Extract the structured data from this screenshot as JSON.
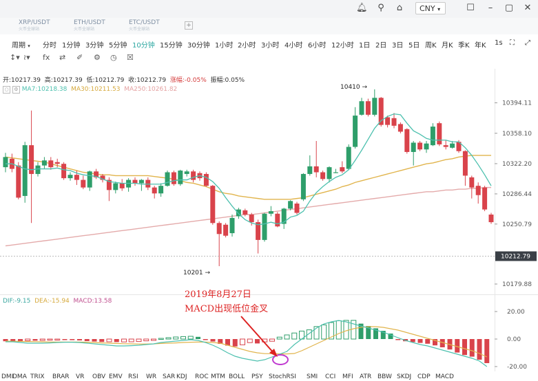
{
  "topbar": {
    "icons": [
      "bell-icon",
      "search-icon",
      "shirt-icon",
      "calendar-icon",
      "minimize-icon",
      "maximize-icon",
      "close-icon"
    ],
    "currency": "CNY"
  },
  "tabs": [
    {
      "label": "XRP/USDT",
      "sub": "火币全球站"
    },
    {
      "label": "ETH/USDT",
      "sub": "火币全球站"
    },
    {
      "label": "ETC/USDT",
      "sub": "火币全球站"
    }
  ],
  "periods": [
    "周期",
    "分时",
    "1分钟",
    "3分钟",
    "5分钟",
    "10分钟",
    "15分钟",
    "30分钟",
    "1小时",
    "2小时",
    "3小时",
    "4小时",
    "6小时",
    "12小时",
    "1日",
    "2日",
    "3日",
    "5日",
    "周K",
    "月K",
    "季K",
    "年K",
    "1s"
  ],
  "active_period": "10分钟",
  "ohlc": {
    "open": "开:10217.39",
    "high": "高:10217.39",
    "low": "低:10212.79",
    "close": "收:10212.79",
    "change": "涨幅:-0.05%",
    "amplitude": "振幅:0.05%"
  },
  "ma": {
    "ma7": "MA7:10218.38",
    "ma30": "MA30:10211.53",
    "ma250": "MA250:10261.82"
  },
  "macd_legend": {
    "dif": "DIF:-9.15",
    "dea": "DEA:-15.94",
    "macd": "MACD:13.58"
  },
  "annotation": {
    "line1": "2019年8月27日",
    "line2": "MACD出现低位金叉"
  },
  "price_markers": {
    "high": "10410",
    "low": "10201",
    "current": "10212.79"
  },
  "indicators": [
    "DMI",
    "DMA",
    "TRIX",
    "BRAR",
    "VR",
    "OBV",
    "EMV",
    "RSI",
    "WR",
    "SAR",
    "KDJ",
    "ROC",
    "MTM",
    "BOLL",
    "PSY",
    "StochRSI",
    "SMI",
    "CCI",
    "MFI",
    "ATR",
    "BBW",
    "SKDJ",
    "CDP",
    "MACD"
  ],
  "colors": {
    "up": "#2e9e6a",
    "down": "#d9434b",
    "ma7": "#4cc0ae",
    "ma30": "#e1b44c",
    "ma250": "#e4aaaa",
    "active": "#2aa6a0"
  },
  "chart_data": [
    {
      "type": "candlestick",
      "y_axis_ticks": [
        10394.11,
        10358.1,
        10322.2,
        10286.44,
        10250.79,
        10179.88
      ],
      "ylim": [
        10170,
        10420
      ],
      "high_marker": 10410,
      "low_marker": 10201,
      "last_price": 10212.79,
      "candles": [
        [
          10318,
          10330,
          10312,
          10335
        ],
        [
          10328,
          10316,
          10312,
          10334
        ],
        [
          10320,
          10282,
          10280,
          10324
        ],
        [
          10284,
          10344,
          10276,
          10348
        ],
        [
          10344,
          10310,
          10252,
          10385
        ],
        [
          10310,
          10320,
          10307,
          10324
        ],
        [
          10320,
          10326,
          10316,
          10330
        ],
        [
          10326,
          10318,
          10315,
          10330
        ],
        [
          10324,
          10322,
          10318,
          10328
        ],
        [
          10322,
          10305,
          10303,
          10324
        ],
        [
          10305,
          10309,
          10302,
          10312
        ],
        [
          10309,
          10303,
          10297,
          10314
        ],
        [
          10303,
          10294,
          10292,
          10308
        ],
        [
          10294,
          10313,
          10290,
          10314
        ],
        [
          10313,
          10306,
          10304,
          10316
        ],
        [
          10308,
          10303,
          10300,
          10310
        ],
        [
          10303,
          10291,
          10278,
          10306
        ],
        [
          10291,
          10299,
          10287,
          10301
        ],
        [
          10299,
          10293,
          10290,
          10304
        ],
        [
          10294,
          10303,
          10289,
          10305
        ],
        [
          10303,
          10299,
          10296,
          10306
        ],
        [
          10299,
          10303,
          10290,
          10304
        ],
        [
          10303,
          10294,
          10291,
          10306
        ],
        [
          10294,
          10287,
          10281,
          10296
        ],
        [
          10287,
          10296,
          10283,
          10299
        ],
        [
          10296,
          10312,
          10295,
          10314
        ],
        [
          10312,
          10298,
          10296,
          10314
        ],
        [
          10298,
          10314,
          10296,
          10315
        ],
        [
          10310,
          10313,
          10307,
          10315
        ],
        [
          10313,
          10303,
          10300,
          10315
        ],
        [
          10311,
          10305,
          10302,
          10313
        ],
        [
          10310,
          10296,
          10295,
          10312
        ],
        [
          10296,
          10252,
          10250,
          10297
        ],
        [
          10252,
          10239,
          10201,
          10254
        ],
        [
          10250,
          10237,
          10235,
          10252
        ],
        [
          10240,
          10258,
          10236,
          10262
        ],
        [
          10260,
          10268,
          10257,
          10270
        ],
        [
          10267,
          10262,
          10260,
          10269
        ],
        [
          10262,
          10253,
          10249,
          10264
        ],
        [
          10253,
          10232,
          10216,
          10256
        ],
        [
          10232,
          10263,
          10230,
          10264
        ],
        [
          10263,
          10266,
          10260,
          10272
        ],
        [
          10263,
          10248,
          10247,
          10265
        ],
        [
          10251,
          10269,
          10245,
          10270
        ],
        [
          10269,
          10278,
          10267,
          10279
        ],
        [
          10275,
          10264,
          10262,
          10277
        ],
        [
          10280,
          10310,
          10278,
          10311
        ],
        [
          10310,
          10319,
          10308,
          10332
        ],
        [
          10319,
          10312,
          10306,
          10349
        ],
        [
          10312,
          10304,
          10302,
          10314
        ],
        [
          10304,
          10318,
          10300,
          10319
        ],
        [
          10312,
          10312,
          10311,
          10316
        ],
        [
          10318,
          10313,
          10311,
          10325
        ],
        [
          10316,
          10342,
          10315,
          10345
        ],
        [
          10342,
          10379,
          10340,
          10389
        ],
        [
          10380,
          10396,
          10379,
          10400
        ],
        [
          10396,
          10380,
          10378,
          10399
        ],
        [
          10380,
          10400,
          10378,
          10410
        ],
        [
          10400,
          10368,
          10366,
          10401
        ],
        [
          10377,
          10368,
          10365,
          10379
        ],
        [
          10376,
          10367,
          10364,
          10382
        ],
        [
          10369,
          10360,
          10358,
          10371
        ],
        [
          10363,
          10336,
          10334,
          10364
        ],
        [
          10336,
          10347,
          10320,
          10349
        ],
        [
          10347,
          10339,
          10337,
          10349
        ],
        [
          10339,
          10346,
          10335,
          10349
        ],
        [
          10344,
          10366,
          10343,
          10370
        ],
        [
          10370,
          10345,
          10343,
          10372
        ],
        [
          10344,
          10342,
          10339,
          10350
        ],
        [
          10341,
          10346,
          10340,
          10349
        ],
        [
          10348,
          10337,
          10335,
          10350
        ],
        [
          10337,
          10308,
          10296,
          10338
        ],
        [
          10306,
          10294,
          10281,
          10308
        ],
        [
          10296,
          10285,
          10275,
          10300
        ],
        [
          10294,
          10268,
          10266,
          10296
        ],
        [
          10262,
          10253,
          10251,
          10264
        ]
      ],
      "ma7": [
        10322,
        10322,
        10319,
        10316,
        10315,
        10316,
        10316,
        10316,
        10317,
        10315,
        10314,
        10311,
        10309,
        10308,
        10307,
        10304,
        10301,
        10300,
        10299,
        10299,
        10299,
        10298,
        10298,
        10298,
        10298,
        10300,
        10302,
        10303,
        10303,
        10306,
        10308,
        10306,
        10301,
        10293,
        10282,
        10272,
        10263,
        10256,
        10252,
        10250,
        10251,
        10253,
        10251,
        10253,
        10259,
        10261,
        10266,
        10278,
        10288,
        10295,
        10301,
        10306,
        10309,
        10315,
        10326,
        10338,
        10351,
        10364,
        10373,
        10378,
        10381,
        10380,
        10370,
        10361,
        10357,
        10352,
        10350,
        10350,
        10350,
        10348,
        10348,
        10341,
        10332,
        10321,
        10309,
        10296
      ],
      "ma30": [
        10330,
        10329,
        10328,
        10327,
        10326,
        10325,
        10324,
        10322,
        10320,
        10318,
        10316,
        10314,
        10312,
        10311,
        10310,
        10309,
        10309,
        10308,
        10308,
        10308,
        10308,
        10308,
        10308,
        10307,
        10306,
        10305,
        10304,
        10302,
        10300,
        10299,
        10297,
        10295,
        10292,
        10289,
        10287,
        10286,
        10284,
        10283,
        10282,
        10281,
        10280,
        10280,
        10280,
        10280,
        10280,
        10281,
        10282,
        10284,
        10286,
        10288,
        10290,
        10292,
        10295,
        10297,
        10300,
        10302,
        10304,
        10306,
        10308,
        10310,
        10312,
        10314,
        10316,
        10318,
        10320,
        10322,
        10323,
        10325,
        10327,
        10328,
        10330,
        10331,
        10332,
        10332,
        10332,
        10332
      ],
      "ma250": [
        10225,
        10226,
        10227,
        10228,
        10229,
        10230,
        10231,
        10232,
        10233,
        10234,
        10235,
        10236,
        10237,
        10238,
        10239,
        10240,
        10241,
        10242,
        10243,
        10244,
        10245,
        10246,
        10247,
        10248,
        10249,
        10250,
        10251,
        10252,
        10253,
        10254,
        10255,
        10256,
        10257,
        10258,
        10259,
        10260,
        10261,
        10262,
        10262,
        10263,
        10264,
        10265,
        10266,
        10267,
        10268,
        10269,
        10270,
        10271,
        10272,
        10273,
        10274,
        10275,
        10276,
        10277,
        10278,
        10279,
        10280,
        10281,
        10282,
        10283,
        10284,
        10285,
        10286,
        10287,
        10288,
        10289,
        10289,
        10290,
        10291,
        10291,
        10292,
        10292,
        10293,
        10293,
        10294,
        10294
      ]
    },
    {
      "type": "macd",
      "y_axis_ticks": [
        20.0,
        0.0,
        -20.0
      ],
      "ylim": [
        -25,
        27
      ],
      "hist": [
        -1.6,
        -1.8,
        -2.0,
        -1.2,
        -1.2,
        -1.0,
        -0.8,
        -0.7,
        -0.7,
        -0.8,
        -1.0,
        -1.5,
        -1.8,
        -2.1,
        -2.0,
        -2.2,
        -2.1,
        -2.0,
        -1.8,
        -1.3,
        -1.0,
        0.5,
        1.0,
        1.5,
        1.8,
        2.0,
        1.6,
        -0.6,
        -1.8,
        -3.5,
        -4.8,
        -5.4,
        -4.2,
        -2.6,
        -3.2,
        -2.1,
        -1.6,
        1.4,
        3.0,
        4.4,
        5.8,
        6.7,
        9.1,
        10.3,
        12.0,
        13.3,
        13.6,
        13.6,
        11.2,
        9.5,
        7.8,
        6.0,
        4.0,
        -0.6,
        -1.6,
        -2.2,
        -2.8,
        -3.4,
        -4.6,
        -6.0,
        -7.6,
        -9.8,
        -11.6,
        -12.8,
        -15.0,
        -17.5
      ],
      "dif": [
        -2,
        -2,
        -2.5,
        -3,
        -3,
        -3,
        -2.8,
        -2.5,
        -2.3,
        -2.3,
        -2.5,
        -3,
        -3.5,
        -4,
        -4.5,
        -5,
        -5,
        -4.8,
        -4.5,
        -4,
        -3.5,
        -2.5,
        -2,
        -1.5,
        -1,
        -0.5,
        -1,
        -2.5,
        -4.5,
        -7,
        -10,
        -12.5,
        -14,
        -15,
        -16,
        -15,
        -13,
        -11,
        -9,
        -4,
        0,
        4,
        8,
        11,
        12.5,
        13.5,
        12.5,
        11,
        9.5,
        8,
        6.5,
        5,
        3,
        1,
        -1,
        -2.5,
        -4,
        -5,
        -6.5,
        -8,
        -9.5,
        -11,
        -12.5,
        -14,
        -16,
        -20
      ],
      "dea": [
        -1.5,
        -1.6,
        -1.7,
        -1.8,
        -1.9,
        -2,
        -2.1,
        -2.2,
        -2.2,
        -2.2,
        -2.2,
        -2.3,
        -2.5,
        -2.8,
        -3,
        -3.2,
        -3.4,
        -3.5,
        -3.6,
        -3.6,
        -3.5,
        -3.2,
        -3,
        -2.8,
        -2.5,
        -2.3,
        -2.2,
        -2.2,
        -2.5,
        -3,
        -4.5,
        -6,
        -7.5,
        -9,
        -10,
        -10.6,
        -10.6,
        -10.8,
        -10.8,
        -10.5,
        -8.5,
        -6,
        -3.5,
        -1,
        1.5,
        4,
        6,
        7.5,
        8.5,
        9,
        9,
        8.5,
        7.5,
        6.5,
        5,
        3.5,
        2,
        0.5,
        -1,
        -2.5,
        -4,
        -5.5,
        -7,
        -8.5,
        -10.5,
        -13
      ]
    }
  ]
}
